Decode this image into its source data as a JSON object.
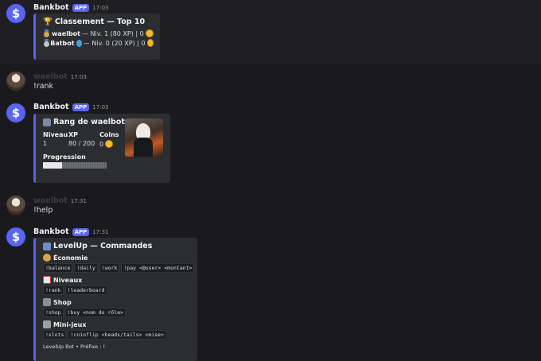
{
  "hover_icons": [
    "link-icon",
    "trash-icon",
    "pin-icon",
    "reply-icon",
    "more-icon"
  ],
  "hover_glyphs": [
    "⛓",
    "▣",
    "✱",
    "➹",
    "⋯"
  ],
  "messages": [
    {
      "author": "Bankbot",
      "app_tag": "APP",
      "time": "17:03",
      "embed": {
        "title": "Classement — Top 10",
        "lines": [
          {
            "name": "waelbot",
            "text": "— Niv. 1 (80 XP) | 0"
          },
          {
            "name": "Batbot",
            "text": "— Niv. 0 (20 XP) | 0"
          }
        ]
      }
    },
    {
      "author": "waelbot",
      "time": "17:03",
      "text": "!rank"
    },
    {
      "author": "Bankbot",
      "app_tag": "APP",
      "time": "17:03",
      "embed": {
        "title": "Rang de waelbot",
        "fields": [
          {
            "name": "Niveau",
            "value": "1"
          },
          {
            "name": "XP",
            "value": "80 / 200"
          },
          {
            "name": "Coins",
            "value": "0"
          }
        ],
        "progress_label": "Progression",
        "progress": 0.3
      }
    },
    {
      "author": "waelbot",
      "time": "17:31",
      "text": "!help"
    },
    {
      "author": "Bankbot",
      "app_tag": "APP",
      "time": "17:31",
      "embed": {
        "title": "LevelUp — Commandes",
        "sections": [
          {
            "title": "Économie",
            "commands": [
              "!balance",
              "!daily",
              "!work",
              "!pay <@user> <montant>"
            ]
          },
          {
            "title": "Niveaux",
            "commands": [
              "!rank",
              "!leaderboard"
            ]
          },
          {
            "title": "Shop",
            "commands": [
              "!shop",
              "!buy <nom du rôle>"
            ]
          },
          {
            "title": "Mini-jeux",
            "commands": [
              "!slots",
              "!coinflip <heads/tails> <mise>"
            ]
          }
        ],
        "footer": "LevelUp Bot • Préfixe : !"
      }
    }
  ]
}
